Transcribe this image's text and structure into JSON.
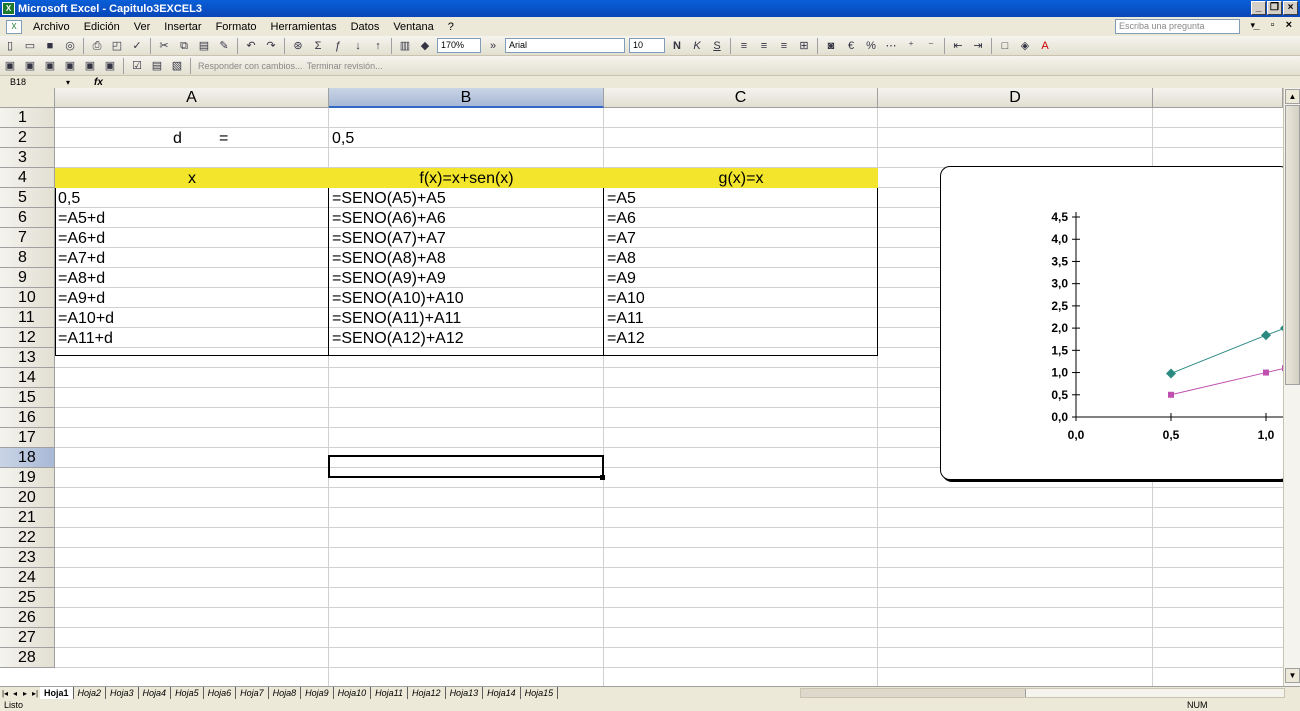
{
  "window": {
    "title": "Microsoft Excel - Capitulo3EXCEL3",
    "app_icon": "excel-icon"
  },
  "menu": [
    "Archivo",
    "Edición",
    "Ver",
    "Insertar",
    "Formato",
    "Herramientas",
    "Datos",
    "Ventana",
    "?"
  ],
  "ask_placeholder": "Escriba una pregunta",
  "toolbar": {
    "zoom": "170%",
    "font": "Arial",
    "size": "10",
    "reply": "Responder con cambios...",
    "end_review": "Terminar revisión..."
  },
  "name_box": "B18",
  "fx_label": "fx",
  "columns": [
    "A",
    "B",
    "C",
    "D"
  ],
  "rows": [
    "1",
    "2",
    "3",
    "4",
    "5",
    "6",
    "7",
    "8",
    "9",
    "10",
    "11",
    "12",
    "13",
    "14",
    "15",
    "16",
    "17",
    "18",
    "19",
    "20",
    "21",
    "22",
    "23",
    "24",
    "25",
    "26",
    "27",
    "28"
  ],
  "cells": {
    "a2": "d",
    "a2eq": "=",
    "b2": "0,5",
    "headers": [
      "x",
      "f(x)=x+sen(x)",
      "g(x)=x"
    ],
    "table": [
      [
        "0,5",
        "=SENO(A5)+A5",
        "=A5"
      ],
      [
        "=A5+d",
        "=SENO(A6)+A6",
        "=A6"
      ],
      [
        "=A6+d",
        "=SENO(A7)+A7",
        "=A7"
      ],
      [
        "=A7+d",
        "=SENO(A8)+A8",
        "=A8"
      ],
      [
        "=A8+d",
        "=SENO(A9)+A9",
        "=A9"
      ],
      [
        "=A9+d",
        "=SENO(A10)+A10",
        "=A10"
      ],
      [
        "=A10+d",
        "=SENO(A11)+A11",
        "=A11"
      ],
      [
        "=A11+d",
        "=SENO(A12)+A12",
        "=A12"
      ]
    ]
  },
  "chart_data": {
    "type": "line",
    "y_ticks": [
      "4,5",
      "4,0",
      "3,5",
      "3,0",
      "2,5",
      "2,0",
      "1,5",
      "1,0",
      "0,5",
      "0,0"
    ],
    "x_ticks": [
      "0,0",
      "0,5",
      "1,0"
    ],
    "ylim": [
      0,
      4.5
    ],
    "xlim": [
      0,
      1.0
    ],
    "series": [
      {
        "color": "#2a8a80",
        "marker": "diamond",
        "x": [
          0.5,
          1.0,
          1.1
        ],
        "y": [
          0.98,
          1.84,
          2.0
        ]
      },
      {
        "color": "#c050b0",
        "marker": "square",
        "x": [
          0.5,
          1.0,
          1.1
        ],
        "y": [
          0.5,
          1.0,
          1.1
        ]
      }
    ]
  },
  "sheets": [
    "Hoja1",
    "Hoja2",
    "Hoja3",
    "Hoja4",
    "Hoja5",
    "Hoja6",
    "Hoja7",
    "Hoja8",
    "Hoja9",
    "Hoja10",
    "Hoja11",
    "Hoja12",
    "Hoja13",
    "Hoja14",
    "Hoja15"
  ],
  "status": {
    "left": "Listo",
    "num": "NUM"
  }
}
